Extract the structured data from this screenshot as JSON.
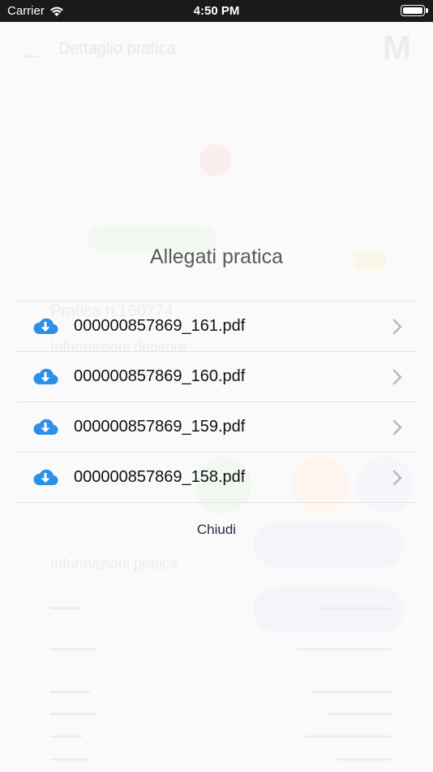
{
  "status_bar": {
    "carrier": "Carrier",
    "time": "4:50 PM"
  },
  "background": {
    "title": "Dettaglio pratica",
    "pratica_label": "Pratica n.160774",
    "info_debitore": "Informazioni debitore",
    "info_pratica": "Informazioni pratica"
  },
  "modal": {
    "title": "Allegati pratica",
    "attachments": [
      {
        "name": "000000857869_161.pdf"
      },
      {
        "name": "000000857869_160.pdf"
      },
      {
        "name": "000000857869_159.pdf"
      },
      {
        "name": "000000857869_158.pdf"
      }
    ],
    "close_label": "Chiudi"
  },
  "colors": {
    "cloud_icon": "#2c8fe8",
    "chevron": "#b8b8bc",
    "close_text": "#1f2a4d"
  }
}
